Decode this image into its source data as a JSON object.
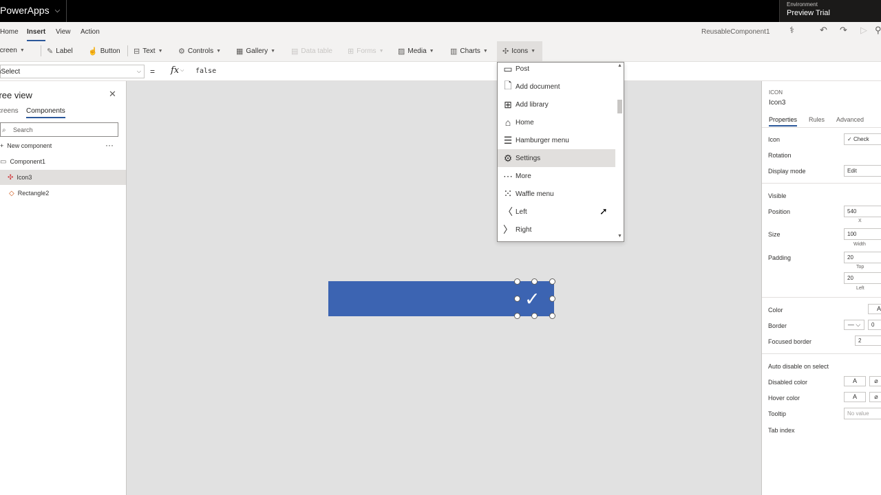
{
  "app": {
    "title": "PowerApps",
    "environment_label": "Environment",
    "environment_name": "Preview Trial",
    "name": "ReusableComponent1"
  },
  "menu": [
    "Home",
    "Insert",
    "View",
    "Action"
  ],
  "toolbar": {
    "new_screen": "New screen",
    "label": "Label",
    "button": "Button",
    "text": "Text",
    "controls": "Controls",
    "gallery": "Gallery",
    "data_table": "Data table",
    "forms": "Forms",
    "media": "Media",
    "charts": "Charts",
    "icons": "Icons"
  },
  "formula_bar": {
    "property": "OnSelect",
    "equals": "=",
    "fx": "fx",
    "formula": "false"
  },
  "tree_view": {
    "title": "Tree view",
    "tabs": [
      "Screens",
      "Components"
    ],
    "search_placeholder": "Search",
    "new_component": "New component",
    "more": "···",
    "items": [
      "Component1",
      "Icon3",
      "Rectangle2"
    ]
  },
  "icons_dropdown": {
    "items": [
      {
        "label": "Post",
        "icon": "post-icon"
      },
      {
        "label": "Add document",
        "icon": "add-document-icon"
      },
      {
        "label": "Add library",
        "icon": "add-library-icon"
      },
      {
        "label": "Home",
        "icon": "home-icon"
      },
      {
        "label": "Hamburger menu",
        "icon": "hamburger-menu-icon"
      },
      {
        "label": "Settings",
        "icon": "settings-icon"
      },
      {
        "label": "More",
        "icon": "more-icon"
      },
      {
        "label": "Waffle menu",
        "icon": "waffle-menu-icon"
      },
      {
        "label": "Left",
        "icon": "left-icon"
      },
      {
        "label": "Right",
        "icon": "right-icon"
      }
    ],
    "highlighted": "Settings"
  },
  "properties_panel": {
    "type": "ICON",
    "name": "Icon3",
    "tabs": [
      "Properties",
      "Rules",
      "Advanced"
    ],
    "icon_label": "Icon",
    "icon_value": "Check",
    "rotation_label": "Rotation",
    "display_mode_label": "Display mode",
    "display_mode_value": "Edit",
    "visible_label": "Visible",
    "position_label": "Position",
    "position_x": "540",
    "position_x_label": "X",
    "size_label": "Size",
    "size_width": "100",
    "size_width_label": "Width",
    "padding_label": "Padding",
    "padding_top": "20",
    "padding_top_label": "Top",
    "padding_left": "20",
    "padding_left_label": "Left",
    "color_label": "Color",
    "color_value": "A",
    "border_label": "Border",
    "border_style": "—",
    "border_width": "0",
    "focused_border_label": "Focused border",
    "focused_border_value": "2",
    "auto_disable_label": "Auto disable on select",
    "disabled_color_label": "Disabled color",
    "disabled_color_value": "A",
    "hover_color_label": "Hover color",
    "hover_color_value": "A",
    "tooltip_label": "Tooltip",
    "tooltip_placeholder": "No value",
    "tab_index_label": "Tab index"
  },
  "colors": {
    "component_fill": "#3c64b2",
    "accent": "#2b579a"
  }
}
